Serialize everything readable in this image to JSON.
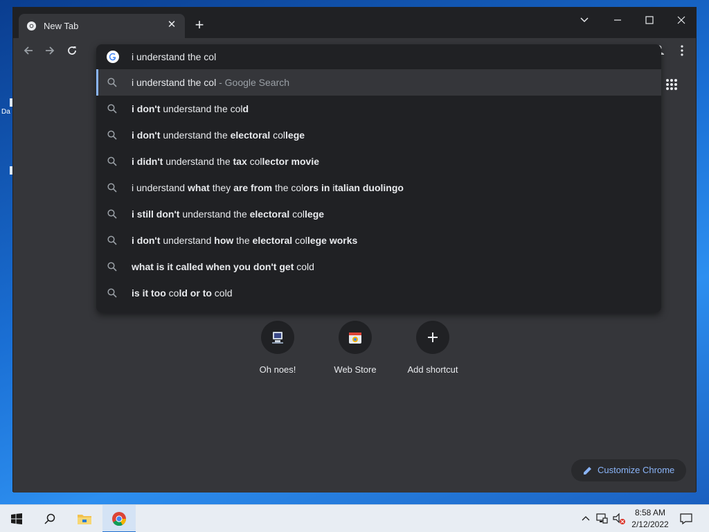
{
  "desktop": {
    "icons": [
      {
        "label": "Da"
      },
      {
        "label": ""
      }
    ]
  },
  "browser": {
    "tab": {
      "title": "New Tab",
      "favicon": "chrome-icon"
    },
    "new_tab_button": "+",
    "window_controls": [
      "tab-search",
      "minimize",
      "maximize",
      "close"
    ],
    "omnibox": {
      "value": "i understand the col",
      "suggestions": [
        {
          "segments": [
            {
              "t": "i understand the col",
              "b": false
            }
          ],
          "hint": " - Google Search",
          "selected": true
        },
        {
          "segments": [
            {
              "t": "i ",
              "b": true
            },
            {
              "t": "don't",
              "b": true
            },
            {
              "t": " understand the col",
              "b": false
            },
            {
              "t": "d",
              "b": true
            }
          ]
        },
        {
          "segments": [
            {
              "t": "i ",
              "b": true
            },
            {
              "t": "don't",
              "b": true
            },
            {
              "t": " understand the ",
              "b": false
            },
            {
              "t": "electoral",
              "b": true
            },
            {
              "t": " col",
              "b": false
            },
            {
              "t": "lege",
              "b": true
            }
          ]
        },
        {
          "segments": [
            {
              "t": "i ",
              "b": true
            },
            {
              "t": "didn't",
              "b": true
            },
            {
              "t": " understand the ",
              "b": false
            },
            {
              "t": "tax",
              "b": true
            },
            {
              "t": " col",
              "b": false
            },
            {
              "t": "lector movie",
              "b": true
            }
          ]
        },
        {
          "segments": [
            {
              "t": "i understand ",
              "b": false
            },
            {
              "t": "what",
              "b": true
            },
            {
              "t": " they ",
              "b": false
            },
            {
              "t": "are from",
              "b": true
            },
            {
              "t": " the col",
              "b": false
            },
            {
              "t": "ors in",
              "b": true
            },
            {
              "t": " i",
              "b": false
            },
            {
              "t": "talian duolingo",
              "b": true
            }
          ]
        },
        {
          "segments": [
            {
              "t": "i ",
              "b": true
            },
            {
              "t": "still don't",
              "b": true
            },
            {
              "t": " understand the ",
              "b": false
            },
            {
              "t": "electoral",
              "b": true
            },
            {
              "t": " col",
              "b": false
            },
            {
              "t": "lege",
              "b": true
            }
          ]
        },
        {
          "segments": [
            {
              "t": "i ",
              "b": true
            },
            {
              "t": "don't",
              "b": true
            },
            {
              "t": " understand ",
              "b": false
            },
            {
              "t": "how",
              "b": true
            },
            {
              "t": " the ",
              "b": false
            },
            {
              "t": "electoral",
              "b": true
            },
            {
              "t": " col",
              "b": false
            },
            {
              "t": "lege works",
              "b": true
            }
          ]
        },
        {
          "segments": [
            {
              "t": "what is it called when you don't get",
              "b": true
            },
            {
              "t": " cold",
              "b": false
            }
          ]
        },
        {
          "segments": [
            {
              "t": "is it too",
              "b": true
            },
            {
              "t": " co",
              "b": false
            },
            {
              "t": "ld",
              "b": true
            },
            {
              "t": " or to",
              "b": true
            },
            {
              "t": " cold",
              "b": false
            }
          ]
        }
      ]
    },
    "ntp": {
      "shortcuts": [
        {
          "name": "Oh noes!",
          "icon": "oh-noes-icon"
        },
        {
          "name": "Web Store",
          "icon": "web-store-icon"
        },
        {
          "name": "Add shortcut",
          "icon": "plus-icon"
        }
      ],
      "customize_label": "Customize Chrome"
    }
  },
  "taskbar": {
    "clock_time": "8:58 AM",
    "clock_date": "2/12/2022",
    "pinned": [
      "start-icon",
      "search-icon",
      "file-explorer-icon",
      "chrome-icon"
    ]
  },
  "colors": {
    "window_bg": "#35363a",
    "titlebar_bg": "#202124",
    "omnibox_bg": "#202124",
    "accent": "#8ab4f8",
    "taskbar_bg": "#e8edf3"
  }
}
